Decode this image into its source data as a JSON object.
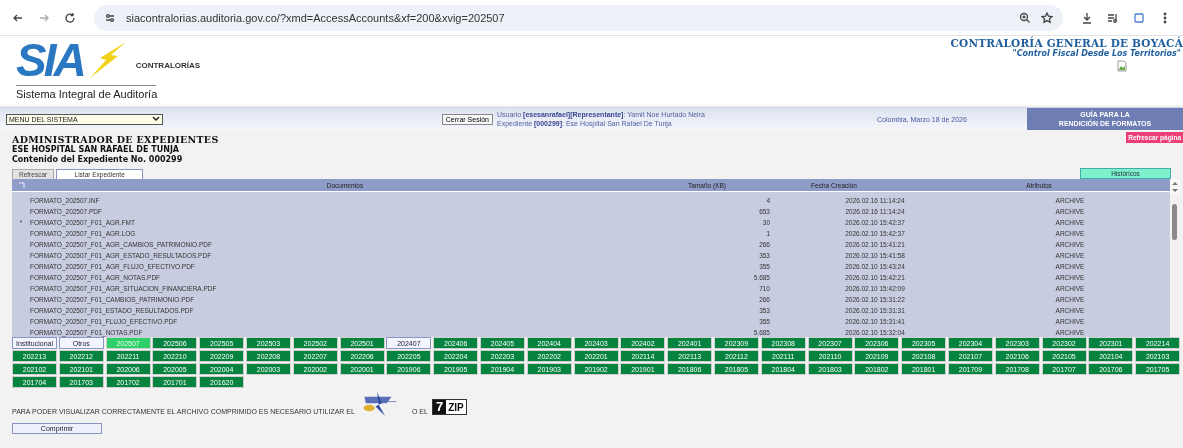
{
  "browser": {
    "url": "siacontralorias.auditoria.gov.co/?xmd=AccessAccounts&xf=200&xvig=202507"
  },
  "header": {
    "logo_text": "SIA",
    "logo_subtitle": "CONTRALORÍAS",
    "logo_caption": "Sistema Integral de Auditoría",
    "org_name": "CONTRALORÍA GENERAL DE BOYACÁ",
    "org_motto": "\"Control Fiscal Desde Los Territorios\""
  },
  "nav": {
    "menu_select": "MENU DEL SISTEMA",
    "logout_button": "Cerrar Sesión",
    "user_line": "Usuario **[esesanrafael][Representante]**: Yamit Noe Hurtado Neira",
    "file_line": "Expediente **[000299]**: Ese Hospital San Rafael De Tunja",
    "date": "Colombia, Marzo 18 de 2026",
    "guide_lines": [
      "GUÍA PARA LA",
      "RENDICIÓN DE FORMATOS"
    ]
  },
  "refresh_page_button": "Refrescar página",
  "titles": [
    "ADMINISTRADOR DE EXPEDIENTES",
    "ESE HOSPITAL SAN RAFAEL DE TUNJA",
    "Contenido del Expediente No. 000299"
  ],
  "tabs": [
    {
      "label": "Refrescar",
      "selected": false
    },
    {
      "label": "Listar Expediente",
      "selected": true
    }
  ],
  "history_button": "Históricos",
  "table": {
    "columns": [
      "Documentos",
      "Tamaño (KB)",
      "Fecha Creación",
      "Atributos"
    ],
    "rows": [
      {
        "name": "FORMATO_202507.INF",
        "size": "4",
        "created": "2026.02.16 11:14:24",
        "attributes": "ARCHIVE"
      },
      {
        "name": "FORMATO_202507.PDF",
        "size": "653",
        "created": "2026.02.16 11:14:24",
        "attributes": "ARCHIVE"
      },
      {
        "marker": "*",
        "name": "FORMATO_202507_F01_AGR.FMT",
        "size": "30",
        "created": "2026.02.10 15:42:37",
        "attributes": "ARCHIVE"
      },
      {
        "name": "FORMATO_202507_F01_AGR.LOG",
        "size": "1",
        "created": "2026.02.10 15:42:37",
        "attributes": "ARCHIVE"
      },
      {
        "name": "FORMATO_202507_F01_AGR_CAMBIOS_PATRIMONIO.PDF",
        "size": "266",
        "created": "2026.02.10 15:41:21",
        "attributes": "ARCHIVE"
      },
      {
        "name": "FORMATO_202507_F01_AGR_ESTADO_RESULTADOS.PDF",
        "size": "353",
        "created": "2026.02.10 15:41:58",
        "attributes": "ARCHIVE"
      },
      {
        "name": "FORMATO_202507_F01_AGR_FLUJO_EFECTIVO.PDF",
        "size": "355",
        "created": "2026.02.10 15:43:24",
        "attributes": "ARCHIVE"
      },
      {
        "name": "FORMATO_202507_F01_AGR_NOTAS.PDF",
        "size": "5.685",
        "created": "2026.02.10 15:42:21",
        "attributes": "ARCHIVE"
      },
      {
        "name": "FORMATO_202507_F01_AGR_SITUACION_FINANCIERA.PDF",
        "size": "710",
        "created": "2026.02.10 15:42:09",
        "attributes": "ARCHIVE"
      },
      {
        "name": "FORMATO_202507_F01_CAMBIOS_PATRIMONIO.PDF",
        "size": "266",
        "created": "2026.02.10 15:31:22",
        "attributes": "ARCHIVE"
      },
      {
        "name": "FORMATO_202507_F01_ESTADO_RESULTADOS.PDF",
        "size": "353",
        "created": "2026.02.10 15:31:31",
        "attributes": "ARCHIVE"
      },
      {
        "name": "FORMATO_202507_F01_FLUJO_EFECTIVO.PDF",
        "size": "355",
        "created": "2026.02.10 15:31:41",
        "attributes": "ARCHIVE"
      },
      {
        "name": "FORMATO_202507_F01_NOTAS.PDF",
        "size": "5.685",
        "created": "2026.02.10 15:32:04",
        "attributes": "ARCHIVE"
      }
    ]
  },
  "periods": [
    {
      "label": "Institucional",
      "kind": "light",
      "selected": false
    },
    {
      "label": "Otros",
      "kind": "light",
      "selected": false
    },
    {
      "label": "202507",
      "kind": "green",
      "selected": true
    },
    {
      "label": "202506",
      "kind": "green",
      "selected": false
    },
    {
      "label": "202505",
      "kind": "green",
      "selected": false
    },
    {
      "label": "202503",
      "kind": "green",
      "selected": false
    },
    {
      "label": "202502",
      "kind": "green",
      "selected": false
    },
    {
      "label": "202501",
      "kind": "green",
      "selected": false
    },
    {
      "label": "202407",
      "kind": "light",
      "selected": false
    },
    {
      "label": "202406",
      "kind": "green",
      "selected": false
    },
    {
      "label": "202405",
      "kind": "green",
      "selected": false
    },
    {
      "label": "202404",
      "kind": "green",
      "selected": false
    },
    {
      "label": "202403",
      "kind": "green",
      "selected": false
    },
    {
      "label": "202402",
      "kind": "green",
      "selected": false
    },
    {
      "label": "202401",
      "kind": "green",
      "selected": false
    },
    {
      "label": "202309",
      "kind": "green",
      "selected": false
    },
    {
      "label": "202308",
      "kind": "green",
      "selected": false
    },
    {
      "label": "202307",
      "kind": "green",
      "selected": false
    },
    {
      "label": "202306",
      "kind": "green",
      "selected": false
    },
    {
      "label": "202305",
      "kind": "green",
      "selected": false
    },
    {
      "label": "202304",
      "kind": "green",
      "selected": false
    },
    {
      "label": "202303",
      "kind": "green",
      "selected": false
    },
    {
      "label": "202302",
      "kind": "green",
      "selected": false
    },
    {
      "label": "202301",
      "kind": "green",
      "selected": false
    },
    {
      "label": "202214",
      "kind": "green",
      "selected": false
    },
    {
      "label": "202213",
      "kind": "green",
      "selected": false
    },
    {
      "label": "202212",
      "kind": "green",
      "selected": false
    },
    {
      "label": "202211",
      "kind": "green",
      "selected": false
    },
    {
      "label": "202210",
      "kind": "green",
      "selected": false
    },
    {
      "label": "202209",
      "kind": "green",
      "selected": false
    },
    {
      "label": "202208",
      "kind": "green",
      "selected": false
    },
    {
      "label": "202207",
      "kind": "green",
      "selected": false
    },
    {
      "label": "202206",
      "kind": "green",
      "selected": false
    },
    {
      "label": "202205",
      "kind": "green",
      "selected": false
    },
    {
      "label": "202204",
      "kind": "green",
      "selected": false
    },
    {
      "label": "202203",
      "kind": "green",
      "selected": false
    },
    {
      "label": "202202",
      "kind": "green",
      "selected": false
    },
    {
      "label": "202201",
      "kind": "green",
      "selected": false
    },
    {
      "label": "202114",
      "kind": "green",
      "selected": false
    },
    {
      "label": "202113",
      "kind": "green",
      "selected": false
    },
    {
      "label": "202112",
      "kind": "green",
      "selected": false
    },
    {
      "label": "202111",
      "kind": "green",
      "selected": false
    },
    {
      "label": "202110",
      "kind": "green",
      "selected": false
    },
    {
      "label": "202109",
      "kind": "green",
      "selected": false
    },
    {
      "label": "202108",
      "kind": "green",
      "selected": false
    },
    {
      "label": "202107",
      "kind": "green",
      "selected": false
    },
    {
      "label": "202106",
      "kind": "green",
      "selected": false
    },
    {
      "label": "202105",
      "kind": "green",
      "selected": false
    },
    {
      "label": "202104",
      "kind": "green",
      "selected": false
    },
    {
      "label": "202103",
      "kind": "green",
      "selected": false
    },
    {
      "label": "202102",
      "kind": "green",
      "selected": false
    },
    {
      "label": "202101",
      "kind": "green",
      "selected": false
    },
    {
      "label": "202006",
      "kind": "green",
      "selected": false
    },
    {
      "label": "202005",
      "kind": "green",
      "selected": false
    },
    {
      "label": "202004",
      "kind": "green",
      "selected": false
    },
    {
      "label": "202003",
      "kind": "green",
      "selected": false
    },
    {
      "label": "202002",
      "kind": "green",
      "selected": false
    },
    {
      "label": "202001",
      "kind": "green",
      "selected": false
    },
    {
      "label": "201906",
      "kind": "green",
      "selected": false
    },
    {
      "label": "201905",
      "kind": "green",
      "selected": false
    },
    {
      "label": "201904",
      "kind": "green",
      "selected": false
    },
    {
      "label": "201903",
      "kind": "green",
      "selected": false
    },
    {
      "label": "201902",
      "kind": "green",
      "selected": false
    },
    {
      "label": "201901",
      "kind": "green",
      "selected": false
    },
    {
      "label": "201806",
      "kind": "green",
      "selected": false
    },
    {
      "label": "201805",
      "kind": "green",
      "selected": false
    },
    {
      "label": "201804",
      "kind": "green",
      "selected": false
    },
    {
      "label": "201803",
      "kind": "green",
      "selected": false
    },
    {
      "label": "201802",
      "kind": "green",
      "selected": false
    },
    {
      "label": "201801",
      "kind": "green",
      "selected": false
    },
    {
      "label": "201709",
      "kind": "green",
      "selected": false
    },
    {
      "label": "201708",
      "kind": "green",
      "selected": false
    },
    {
      "label": "201707",
      "kind": "green",
      "selected": false
    },
    {
      "label": "201706",
      "kind": "green",
      "selected": false
    },
    {
      "label": "201705",
      "kind": "green",
      "selected": false
    },
    {
      "label": "201704",
      "kind": "green",
      "selected": false
    },
    {
      "label": "201703",
      "kind": "green",
      "selected": false
    },
    {
      "label": "201702",
      "kind": "green",
      "selected": false
    },
    {
      "label": "201701",
      "kind": "green",
      "selected": false
    },
    {
      "label": "201620",
      "kind": "green",
      "selected": false
    }
  ],
  "footer": {
    "notice": "PARA PODER VISUALIZAR CORRECTAMENTE EL ARCHIVO COMPRIMIDO ES NECESARIO UTILIZAR EL",
    "or_text": "O EL",
    "sevenzip_mark": "7",
    "sevenzip_word": "ZIP",
    "compress_button": "Comprimir"
  }
}
